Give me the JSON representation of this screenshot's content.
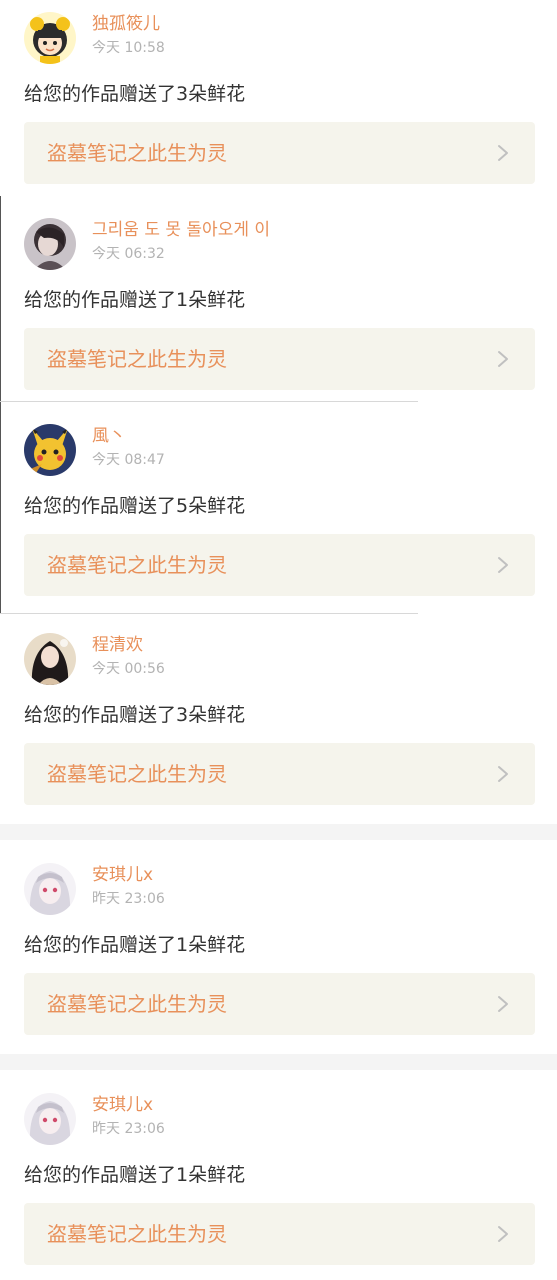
{
  "notifications": [
    {
      "username": "独孤筱儿",
      "time": "今天 10:58",
      "message": "给您的作品赠送了3朵鲜花",
      "work_title": "盗墓笔记之此生为灵",
      "avatar_icon": "cartoon-girl-avatar"
    },
    {
      "username": "그리움 도 못 돌아오게 이",
      "time": "今天 06:32",
      "message": "给您的作品赠送了1朵鲜花",
      "work_title": "盗墓笔记之此生为灵",
      "avatar_icon": "dark-haired-girl-avatar"
    },
    {
      "username": "風丶",
      "time": "今天 08:47",
      "message": "给您的作品赠送了5朵鲜花",
      "work_title": "盗墓笔记之此生为灵",
      "avatar_icon": "yellow-creature-avatar"
    },
    {
      "username": "程清欢",
      "time": "今天 00:56",
      "message": "给您的作品赠送了3朵鲜花",
      "work_title": "盗墓笔记之此生为灵",
      "avatar_icon": "long-hair-girl-avatar"
    },
    {
      "username": "安琪儿x",
      "time": "昨天 23:06",
      "message": "给您的作品赠送了1朵鲜花",
      "work_title": "盗墓笔记之此生为灵",
      "avatar_icon": "silver-hair-anime-avatar"
    },
    {
      "username": "安琪儿x",
      "time": "昨天 23:06",
      "message": "给您的作品赠送了1朵鲜花",
      "work_title": "盗墓笔记之此生为灵",
      "avatar_icon": "silver-hair-anime-avatar"
    }
  ],
  "colors": {
    "username": "#e8905a",
    "time": "#b3b3b3",
    "message": "#333333",
    "link_background": "#f5f4ec",
    "link_text": "#e8905a",
    "chevron": "#c0c0c0"
  }
}
